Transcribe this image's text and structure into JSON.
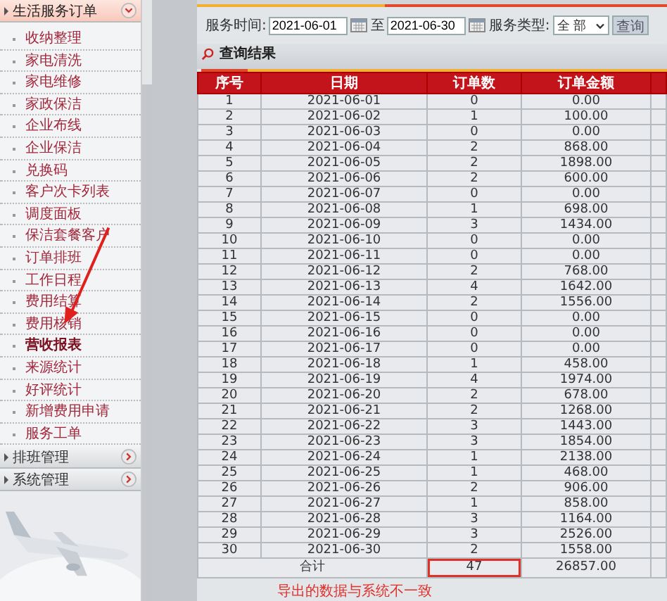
{
  "sidebar": {
    "sections": [
      {
        "title": "生活服务订单",
        "expanded": true,
        "items": [
          {
            "label": "收纳整理",
            "selected": false
          },
          {
            "label": "家电清洗",
            "selected": false
          },
          {
            "label": "家电维修",
            "selected": false
          },
          {
            "label": "家政保洁",
            "selected": false
          },
          {
            "label": "企业布线",
            "selected": false
          },
          {
            "label": "企业保洁",
            "selected": false
          },
          {
            "label": "兑换码",
            "selected": false
          },
          {
            "label": "客户次卡列表",
            "selected": false
          },
          {
            "label": "调度面板",
            "selected": false
          },
          {
            "label": "保洁套餐客户",
            "selected": false
          },
          {
            "label": "订单排班",
            "selected": false
          },
          {
            "label": "工作日程",
            "selected": false
          },
          {
            "label": "费用结算",
            "selected": false
          },
          {
            "label": "费用核销",
            "selected": false
          },
          {
            "label": "营收报表",
            "selected": true
          },
          {
            "label": "来源统计",
            "selected": false
          },
          {
            "label": "好评统计",
            "selected": false
          },
          {
            "label": "新增费用申请",
            "selected": false
          },
          {
            "label": "服务工单",
            "selected": false
          }
        ]
      },
      {
        "title": "排班管理",
        "expanded": false
      },
      {
        "title": "系统管理",
        "expanded": false
      }
    ]
  },
  "query": {
    "date_label": "服务时间:",
    "date_from": "2021-06-01",
    "to_label": "至",
    "date_to": "2021-06-30",
    "type_label": "服务类型:",
    "type_value": "全 部",
    "button": "查询"
  },
  "results": {
    "title": "查询结果",
    "columns": [
      "序号",
      "日期",
      "订单数",
      "订单金额"
    ],
    "rows": [
      [
        "1",
        "2021-06-01",
        "0",
        "0.00"
      ],
      [
        "2",
        "2021-06-02",
        "1",
        "100.00"
      ],
      [
        "3",
        "2021-06-03",
        "0",
        "0.00"
      ],
      [
        "4",
        "2021-06-04",
        "2",
        "868.00"
      ],
      [
        "5",
        "2021-06-05",
        "2",
        "1898.00"
      ],
      [
        "6",
        "2021-06-06",
        "2",
        "600.00"
      ],
      [
        "7",
        "2021-06-07",
        "0",
        "0.00"
      ],
      [
        "8",
        "2021-06-08",
        "1",
        "698.00"
      ],
      [
        "9",
        "2021-06-09",
        "3",
        "1434.00"
      ],
      [
        "10",
        "2021-06-10",
        "0",
        "0.00"
      ],
      [
        "11",
        "2021-06-11",
        "0",
        "0.00"
      ],
      [
        "12",
        "2021-06-12",
        "2",
        "768.00"
      ],
      [
        "13",
        "2021-06-13",
        "4",
        "1642.00"
      ],
      [
        "14",
        "2021-06-14",
        "2",
        "1556.00"
      ],
      [
        "15",
        "2021-06-15",
        "0",
        "0.00"
      ],
      [
        "16",
        "2021-06-16",
        "0",
        "0.00"
      ],
      [
        "17",
        "2021-06-17",
        "0",
        "0.00"
      ],
      [
        "18",
        "2021-06-18",
        "1",
        "458.00"
      ],
      [
        "19",
        "2021-06-19",
        "4",
        "1974.00"
      ],
      [
        "20",
        "2021-06-20",
        "2",
        "678.00"
      ],
      [
        "21",
        "2021-06-21",
        "2",
        "1268.00"
      ],
      [
        "22",
        "2021-06-22",
        "3",
        "1443.00"
      ],
      [
        "23",
        "2021-06-23",
        "3",
        "1854.00"
      ],
      [
        "24",
        "2021-06-24",
        "1",
        "2138.00"
      ],
      [
        "25",
        "2021-06-25",
        "1",
        "468.00"
      ],
      [
        "26",
        "2021-06-26",
        "2",
        "906.00"
      ],
      [
        "27",
        "2021-06-27",
        "1",
        "858.00"
      ],
      [
        "28",
        "2021-06-28",
        "3",
        "1164.00"
      ],
      [
        "29",
        "2021-06-29",
        "3",
        "2526.00"
      ],
      [
        "30",
        "2021-06-30",
        "2",
        "1558.00"
      ]
    ],
    "total": {
      "label": "合计",
      "orders": "47",
      "amount": "26857.00"
    }
  },
  "annotation": {
    "note": "导出的数据与系统不一致"
  }
}
